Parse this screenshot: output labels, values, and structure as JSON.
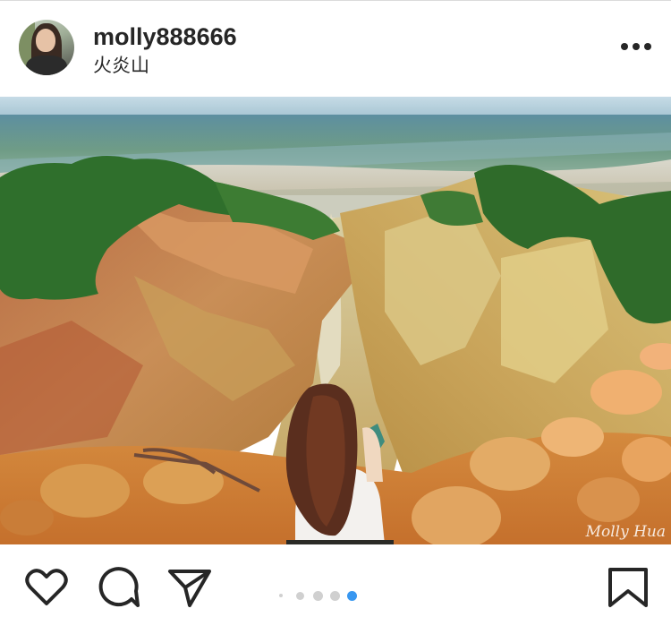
{
  "post": {
    "username": "molly888666",
    "location": "火炎山",
    "watermark": "Molly Hua"
  },
  "carousel": {
    "total": 5,
    "active_index": 4
  },
  "icons": {
    "more": "more-options-icon",
    "like": "heart-icon",
    "comment": "comment-icon",
    "share": "send-icon",
    "save": "bookmark-icon"
  },
  "colors": {
    "text": "#262626",
    "active_dot": "#3897f0",
    "inactive_dot": "#d0d0d0",
    "divider": "#dbdbdb"
  }
}
